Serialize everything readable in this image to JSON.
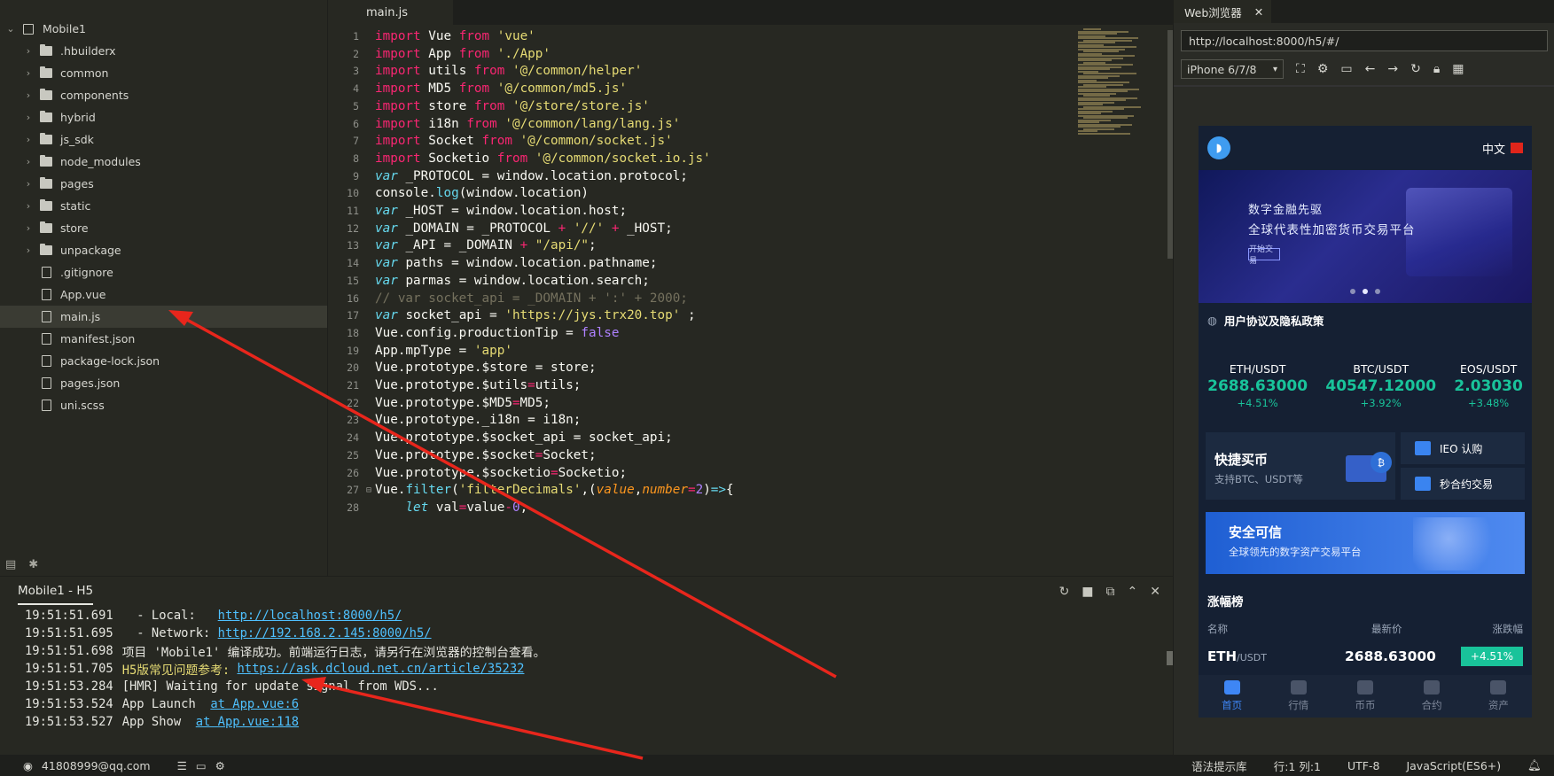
{
  "sidebar": {
    "root_label": "Mobile1",
    "items": [
      {
        "label": ".hbuilderx",
        "type": "folder"
      },
      {
        "label": "common",
        "type": "folder"
      },
      {
        "label": "components",
        "type": "folder"
      },
      {
        "label": "hybrid",
        "type": "folder"
      },
      {
        "label": "js_sdk",
        "type": "folder"
      },
      {
        "label": "node_modules",
        "type": "folder"
      },
      {
        "label": "pages",
        "type": "folder"
      },
      {
        "label": "static",
        "type": "folder"
      },
      {
        "label": "store",
        "type": "folder"
      },
      {
        "label": "unpackage",
        "type": "folder"
      },
      {
        "label": ".gitignore",
        "type": "file"
      },
      {
        "label": "App.vue",
        "type": "file"
      },
      {
        "label": "main.js",
        "type": "file",
        "active": true
      },
      {
        "label": "manifest.json",
        "type": "file"
      },
      {
        "label": "package-lock.json",
        "type": "file"
      },
      {
        "label": "pages.json",
        "type": "file"
      },
      {
        "label": "uni.scss",
        "type": "file"
      }
    ]
  },
  "editor": {
    "tab_label": "main.js",
    "lines": [
      {
        "n": "1",
        "html": "<span class='kw'>import</span> <span class='df'>Vue</span> <span class='kw'>from</span> <span class='st'>'vue'</span>"
      },
      {
        "n": "2",
        "html": "<span class='kw'>import</span> <span class='df'>App</span> <span class='kw'>from</span> <span class='st'>'./App'</span>"
      },
      {
        "n": "3",
        "html": "<span class='kw'>import</span> <span class='df'>utils</span> <span class='kw'>from</span> <span class='st'>'@/common/helper'</span>"
      },
      {
        "n": "4",
        "html": "<span class='kw'>import</span> <span class='df'>MD5</span> <span class='kw'>from</span> <span class='st'>'@/common/md5.js'</span>"
      },
      {
        "n": "5",
        "html": "<span class='kw'>import</span> <span class='df'>store</span> <span class='kw'>from</span> <span class='st'>'@/store/store.js'</span>"
      },
      {
        "n": "6",
        "html": "<span class='kw'>import</span> <span class='df'>i18n</span> <span class='kw'>from</span> <span class='st'>'@/common/lang/lang.js'</span>"
      },
      {
        "n": "7",
        "html": "<span class='kw'>import</span> <span class='df'>Socket</span> <span class='kw'>from</span> <span class='st'>'@/common/socket.js'</span>"
      },
      {
        "n": "8",
        "html": "<span class='kw'>import</span> <span class='df'>Socketio</span> <span class='kw'>from</span> <span class='st'>'@/common/socket.io.js'</span>"
      },
      {
        "n": "9",
        "html": "<span class='vr'>var</span> <span class='df'>_PROTOCOL = window.location.protocol;</span>"
      },
      {
        "n": "10",
        "html": "<span class='df'>console.</span><span class='fn'>log</span><span class='df'>(window.location)</span>"
      },
      {
        "n": "11",
        "html": "<span class='vr'>var</span> <span class='df'>_HOST = window.location.host;</span>"
      },
      {
        "n": "12",
        "html": "<span class='vr'>var</span> <span class='df'>_DOMAIN = _PROTOCOL </span><span class='kw'>+</span> <span class='st'>'//'</span> <span class='kw'>+</span> <span class='df'>_HOST;</span>"
      },
      {
        "n": "13",
        "html": "<span class='vr'>var</span> <span class='df'>_API = _DOMAIN </span><span class='kw'>+</span> <span class='st'>\"/api/\"</span><span class='df'>;</span>"
      },
      {
        "n": "14",
        "html": "<span class='vr'>var</span> <span class='df'>paths = window.location.pathname;</span>"
      },
      {
        "n": "15",
        "html": "<span class='vr'>var</span> <span class='df'>parmas = window.location.search;</span>"
      },
      {
        "n": "16",
        "html": "<span class='cm'>// var socket_api = _DOMAIN + ':' + 2000;</span>"
      },
      {
        "n": "17",
        "html": "<span class='vr'>var</span> <span class='df'>socket_api = </span><span class='st'>'https://jys.trx20.top'</span> <span class='df'>;</span>"
      },
      {
        "n": "18",
        "html": "<span class='df'>Vue.config.productionTip = </span><span class='bool'>false</span>"
      },
      {
        "n": "19",
        "html": "<span class='df'>App.mpType = </span><span class='st'>'app'</span>"
      },
      {
        "n": "20",
        "html": "<span class='df'>Vue.prototype.$store = store;</span>"
      },
      {
        "n": "21",
        "html": "<span class='df'>Vue.prototype.$utils</span><span class='kw'>=</span><span class='df'>utils;</span>"
      },
      {
        "n": "22",
        "html": "<span class='df'>Vue.prototype.$MD5</span><span class='kw'>=</span><span class='df'>MD5;</span>"
      },
      {
        "n": "23",
        "html": "<span class='df'>Vue.prototype._i18n = i18n;</span>"
      },
      {
        "n": "24",
        "html": "<span class='df'>Vue.prototype.$socket_api = socket_api;</span>"
      },
      {
        "n": "25",
        "html": "<span class='df'>Vue.prototype.$socket</span><span class='kw'>=</span><span class='df'>Socket;</span>"
      },
      {
        "n": "26",
        "html": "<span class='df'>Vue.prototype.$socketio</span><span class='kw'>=</span><span class='df'>Socketio;</span>"
      },
      {
        "n": "27",
        "html": "<span class='df'>Vue.</span><span class='fn'>filter</span><span class='df'>(</span><span class='st'>'filterDecimals'</span><span class='df'>,(</span><span class='prm'>value</span><span class='df'>,</span><span class='prm'>number</span><span class='kw'>=</span><span class='bool'>2</span><span class='df'>)</span><span class='vr'>=></span><span class='df'>{</span>",
        "fold": true
      },
      {
        "n": "28",
        "html": "    <span class='vr'>let</span> <span class='df'>val</span><span class='kw'>=</span><span class='df'>value</span><span class='kw'>-</span><span class='bool'>0</span><span class='df'>;</span>"
      }
    ]
  },
  "console": {
    "title": "Mobile1 - H5",
    "lines": [
      {
        "time": "19:51:51.691",
        "text": "  - Local:   ",
        "link": "http://localhost:8000/h5/",
        "style": ""
      },
      {
        "time": "19:51:51.695",
        "text": "  - Network: ",
        "link": "http://192.168.2.145:8000/h5/",
        "style": ""
      },
      {
        "time": "19:51:51.698",
        "text": "项目 'Mobile1' 编译成功。前端运行日志，请另行在浏览器的控制台查看。",
        "link": "",
        "style": ""
      },
      {
        "time": "19:51:51.705",
        "text": "H5版常见问题参考: ",
        "link": "https://ask.dcloud.net.cn/article/35232",
        "style": "warn"
      },
      {
        "time": "19:51:53.284",
        "text": "[HMR] Waiting for update signal from WDS...",
        "link": "",
        "style": ""
      },
      {
        "time": "19:51:53.524",
        "text": "App Launch  ",
        "link": "at App.vue:6",
        "style": ""
      },
      {
        "time": "19:51:53.527",
        "text": "App Show  ",
        "link": "at App.vue:118",
        "style": ""
      }
    ]
  },
  "statusbar": {
    "user": "41808999@qq.com",
    "hint": "语法提示库",
    "position": "行:1  列:1",
    "encoding": "UTF-8",
    "language": "JavaScript(ES6+)"
  },
  "browser": {
    "tab_label": "Web浏览器",
    "url": "http://localhost:8000/h5/#/",
    "device": "iPhone 6/7/8"
  },
  "phone": {
    "lang": "中文",
    "banner_line1": "数字金融先驱",
    "banner_line2": "全球代表性加密货币交易平台",
    "banner_button": "开始交易",
    "notice": "用户协议及隐私政策",
    "tickers": [
      {
        "pair": "ETH/USDT",
        "price": "2688.63000",
        "change": "+4.51%"
      },
      {
        "pair": "BTC/USDT",
        "price": "40547.12000",
        "change": "+3.92%"
      },
      {
        "pair": "EOS/USDT",
        "price": "2.03030",
        "change": "+3.48%"
      }
    ],
    "quick_title": "快捷买币",
    "quick_sub": "支持BTC、USDT等",
    "coin_mark": "₿",
    "ieo_label": "IEO 认购",
    "contract_label": "秒合约交易",
    "safe_title": "安全可信",
    "safe_sub": "全球领先的数字资产交易平台",
    "rank_title": "涨幅榜",
    "rank_headers": {
      "name": "名称",
      "price": "最新价",
      "change": "涨跌幅"
    },
    "rank_row": {
      "coin": "ETH",
      "quote": "/USDT",
      "price": "2688.63000",
      "change": "+4.51%"
    },
    "tabs": [
      "首页",
      "行情",
      "币币",
      "合约",
      "资产"
    ]
  },
  "colors": {
    "accent": "#3e86f5",
    "up": "#19c39a",
    "arrow": "#e8261c"
  }
}
